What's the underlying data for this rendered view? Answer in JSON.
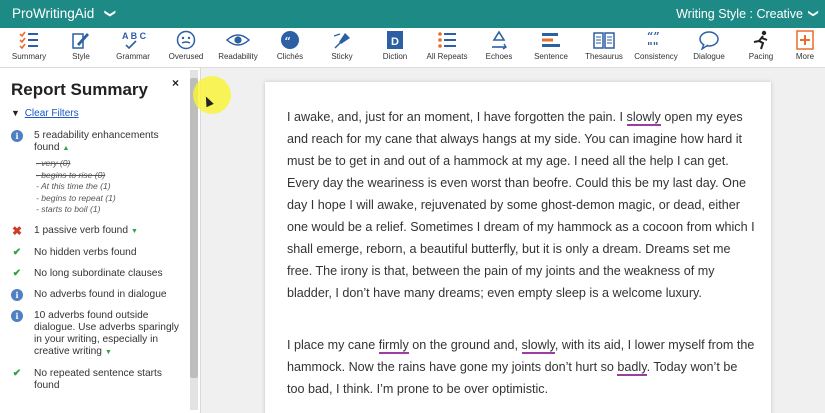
{
  "header": {
    "app_name": "ProWritingAid",
    "app_caret": "❯",
    "style_label": "Writing Style : Creative",
    "style_caret": "❯"
  },
  "toolbar": {
    "tools": [
      {
        "label": "Summary",
        "icon": "summary-icon"
      },
      {
        "label": "Style",
        "icon": "style-icon"
      },
      {
        "label": "Grammar",
        "icon": "grammar-icon"
      },
      {
        "label": "Overused",
        "icon": "overused-icon"
      },
      {
        "label": "Readability",
        "icon": "eye-icon"
      },
      {
        "label": "Clichés",
        "icon": "quote-icon"
      },
      {
        "label": "Sticky",
        "icon": "sticky-icon"
      },
      {
        "label": "Diction",
        "icon": "diction-icon"
      },
      {
        "label": "All Repeats",
        "icon": "list-icon"
      },
      {
        "label": "Echoes",
        "icon": "recycle-icon"
      },
      {
        "label": "Sentence",
        "icon": "sentence-icon"
      },
      {
        "label": "Thesaurus",
        "icon": "book-icon"
      },
      {
        "label": "Consistency",
        "icon": "consistency-icon"
      },
      {
        "label": "Dialogue",
        "icon": "speech-bubble-icon"
      },
      {
        "label": "Pacing",
        "icon": "runner-icon"
      },
      {
        "label": "More",
        "icon": "plus-icon"
      }
    ]
  },
  "sidebar": {
    "title": "Report Summary",
    "close_label": "×",
    "filter_icon": "▼",
    "clear_filters": "Clear Filters",
    "items": [
      {
        "status": "info",
        "glyph": "i",
        "text": "5 readability enhancements found",
        "caret": "▲",
        "sub": [
          {
            "text": "very (0)",
            "struck": true
          },
          {
            "text": "begins to rise (0)",
            "struck": true
          },
          {
            "text": "At this time the (1)",
            "struck": false
          },
          {
            "text": "begins to repeat (1)",
            "struck": false
          },
          {
            "text": "starts to boil (1)",
            "struck": false
          }
        ]
      },
      {
        "status": "bad",
        "glyph": "✖",
        "text": "1 passive verb found",
        "caret": "▼"
      },
      {
        "status": "ok",
        "glyph": "✔",
        "text": "No hidden verbs found"
      },
      {
        "status": "ok",
        "glyph": "✔",
        "text": "No long subordinate clauses"
      },
      {
        "status": "info",
        "glyph": "i",
        "text": "No adverbs found in dialogue"
      },
      {
        "status": "info",
        "glyph": "i",
        "text": "10 adverbs found outside dialogue. Use adverbs sparingly in your writing, especially in creative writing",
        "caret": "▼"
      },
      {
        "status": "ok",
        "glyph": "✔",
        "text": "No repeated sentence starts found"
      }
    ]
  },
  "document": {
    "paragraph1": [
      {
        "text": "I awake, and, just for an moment, I have forgotten the pain. I ",
        "hl": false
      },
      {
        "text": "slowly",
        "hl": true
      },
      {
        "text": " open my eyes and reach for my cane that always hangs at my side. You can imagine how hard it must be to get in and out of a hammock at my age. I need all the help I can get. Every day the weariness is even worst than beofre. Could this be my last day. One day I hope I will awake, rejuvenated by some ghost-demon magic, or dead, either one would be a relief. Sometimes I dream of my hammock as a cocoon from which I shall emerge, reborn, a beautiful butterfly, but it is only a dream. Dreams set me free. The irony is that, between the pain of my joints and the weakness of my bladder, I don’t have many dreams; even empty sleep is a welcome luxury.",
        "hl": false
      }
    ],
    "paragraph2": [
      {
        "text": "I place my cane ",
        "hl": false
      },
      {
        "text": "firmly",
        "hl": true
      },
      {
        "text": " on the ground and, ",
        "hl": false
      },
      {
        "text": "slowly",
        "hl": true
      },
      {
        "text": ", with its aid, I lower myself from the hammock. Now the rains have gone my joints don’t hurt so ",
        "hl": false
      },
      {
        "text": "badly",
        "hl": true
      },
      {
        "text": ". Today won’t be too bad, I think. I’m prone to be over optimistic.",
        "hl": false
      }
    ]
  },
  "colors": {
    "header_bg": "#1e8a86",
    "accent_blue": "#1a57c7",
    "ok_green": "#2fa343",
    "error_red": "#d03a2a",
    "info_blue": "#4f80bf",
    "highlight_underline": "#9a3f9f",
    "icon_blue": "#2c5fa3",
    "icon_orange": "#e76f2b"
  }
}
